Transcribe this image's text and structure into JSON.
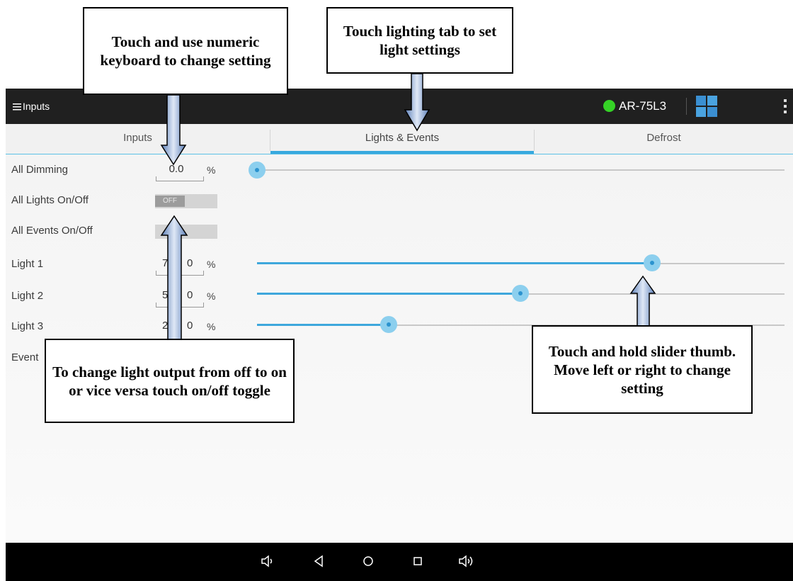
{
  "appbar": {
    "title": "Inputs",
    "device_name": "AR-75L3",
    "status_color": "#35d226"
  },
  "tabs": [
    {
      "label": "Inputs",
      "active": false
    },
    {
      "label": "Lights & Events",
      "active": true
    },
    {
      "label": "Defrost",
      "active": false
    }
  ],
  "rows": {
    "all_dimming": {
      "label": "All Dimming",
      "value": "0.0",
      "unit": "%",
      "level": 0.0
    },
    "all_lights": {
      "label": "All Lights On/Off",
      "state": "OFF"
    },
    "all_events": {
      "label": "All Events On/Off"
    },
    "light1": {
      "label": "Light 1",
      "value": "7",
      "value_tail": "0",
      "unit": "%",
      "level": 0.75
    },
    "light2": {
      "label": "Light 2",
      "value": "5",
      "value_tail": "0",
      "unit": "%",
      "level": 0.5
    },
    "light3": {
      "label": "Light 3",
      "value": "2",
      "value_tail": "0",
      "unit": "%",
      "level": 0.25
    },
    "event": {
      "label": "Event"
    }
  },
  "callouts": {
    "numeric": "Touch and use numeric keyboard to change setting",
    "lighting_tab": "Touch lighting tab to set light settings",
    "toggle": "To change light output from off to on or vice versa touch on/off toggle",
    "slider": "Touch and hold slider thumb.  Move left or right to change setting"
  },
  "colors": {
    "accent": "#37a8de",
    "slider_thumb": "#8ccfee",
    "appbar": "#202020"
  }
}
